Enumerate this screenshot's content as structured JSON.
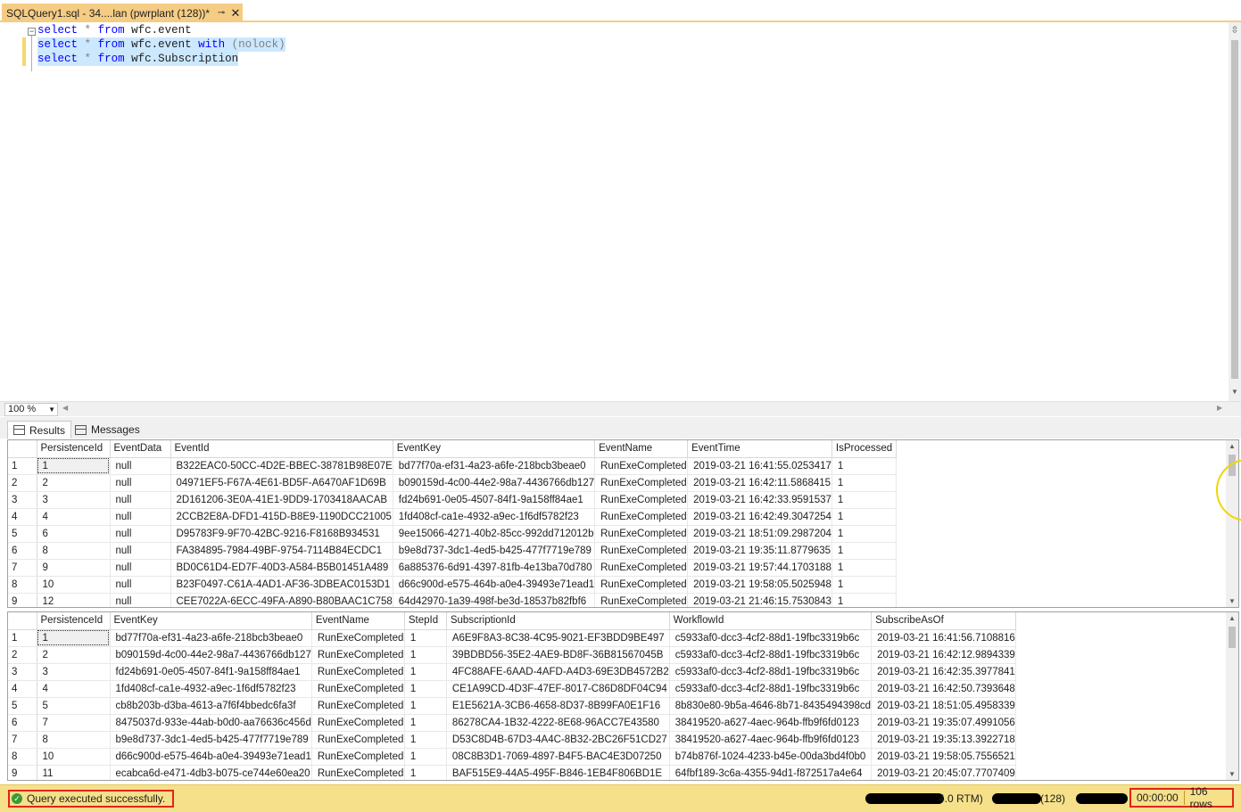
{
  "tab": {
    "title": "SQLQuery1.sql - 34....lan (pwrplant (128))*",
    "pin_icon": "pin-icon",
    "close_icon": "close-icon"
  },
  "editor": {
    "lines": [
      {
        "tokens": [
          "select",
          "*",
          "from",
          "wfc.event"
        ],
        "selected": false
      },
      {
        "tokens": [
          "select",
          "*",
          "from",
          "wfc.event",
          "with",
          "(nolock)"
        ],
        "selected": true
      },
      {
        "tokens": [
          "select",
          "*",
          "from",
          "wfc.Subscription"
        ],
        "selected": true
      }
    ],
    "zoom": "100 %"
  },
  "results_tabs": {
    "results": "Results",
    "messages": "Messages"
  },
  "grid1": {
    "columns": [
      "PersistenceId",
      "EventData",
      "EventId",
      "EventKey",
      "EventName",
      "EventTime",
      "IsProcessed"
    ],
    "rows": [
      [
        "1",
        "1",
        "null",
        "B322EAC0-50CC-4D2E-BBEC-38781B98E07E",
        "bd77f70a-ef31-4a23-a6fe-218bcb3beae0",
        "RunExeCompleted",
        "2019-03-21 16:41:55.0253417",
        "1"
      ],
      [
        "2",
        "2",
        "null",
        "04971EF5-F67A-4E61-BD5F-A6470AF1D69B",
        "b090159d-4c00-44e2-98a7-4436766db127",
        "RunExeCompleted",
        "2019-03-21 16:42:11.5868415",
        "1"
      ],
      [
        "3",
        "3",
        "null",
        "2D161206-3E0A-41E1-9DD9-1703418AACAB",
        "fd24b691-0e05-4507-84f1-9a158ff84ae1",
        "RunExeCompleted",
        "2019-03-21 16:42:33.9591537",
        "1"
      ],
      [
        "4",
        "4",
        "null",
        "2CCB2E8A-DFD1-415D-B8E9-1190DCC21005",
        "1fd408cf-ca1e-4932-a9ec-1f6df5782f23",
        "RunExeCompleted",
        "2019-03-21 16:42:49.3047254",
        "1"
      ],
      [
        "5",
        "6",
        "null",
        "D95783F9-9F70-42BC-9216-F8168B934531",
        "9ee15066-4271-40b2-85cc-992dd712012b",
        "RunExeCompleted",
        "2019-03-21 18:51:09.2987204",
        "1"
      ],
      [
        "6",
        "8",
        "null",
        "FA384895-7984-49BF-9754-7114B84ECDC1",
        "b9e8d737-3dc1-4ed5-b425-477f7719e789",
        "RunExeCompleted",
        "2019-03-21 19:35:11.8779635",
        "1"
      ],
      [
        "7",
        "9",
        "null",
        "BD0C61D4-ED7F-40D3-A584-B5B01451A489",
        "6a885376-6d91-4397-81fb-4e13ba70d780",
        "RunExeCompleted",
        "2019-03-21 19:57:44.1703188",
        "1"
      ],
      [
        "8",
        "10",
        "null",
        "B23F0497-C61A-4AD1-AF36-3DBEAC0153D1",
        "d66c900d-e575-464b-a0e4-39493e71ead1",
        "RunExeCompleted",
        "2019-03-21 19:58:05.5025948",
        "1"
      ],
      [
        "9",
        "12",
        "null",
        "CEE7022A-6ECC-49FA-A890-B80BAAC1C758",
        "64d42970-1a39-498f-be3d-18537b82fbf6",
        "RunExeCompleted",
        "2019-03-21 21:46:15.7530843",
        "1"
      ]
    ]
  },
  "grid2": {
    "columns": [
      "PersistenceId",
      "EventKey",
      "EventName",
      "StepId",
      "SubscriptionId",
      "WorkflowId",
      "SubscribeAsOf"
    ],
    "rows": [
      [
        "1",
        "1",
        "bd77f70a-ef31-4a23-a6fe-218bcb3beae0",
        "RunExeCompleted",
        "1",
        "A6E9F8A3-8C38-4C95-9021-EF3BDD9BE497",
        "c5933af0-dcc3-4cf2-88d1-19fbc3319b6c",
        "2019-03-21 16:41:56.7108816"
      ],
      [
        "2",
        "2",
        "b090159d-4c00-44e2-98a7-4436766db127",
        "RunExeCompleted",
        "1",
        "39BDBD56-35E2-4AE9-BD8F-36B81567045B",
        "c5933af0-dcc3-4cf2-88d1-19fbc3319b6c",
        "2019-03-21 16:42:12.9894339"
      ],
      [
        "3",
        "3",
        "fd24b691-0e05-4507-84f1-9a158ff84ae1",
        "RunExeCompleted",
        "1",
        "4FC88AFE-6AAD-4AFD-A4D3-69E3DB4572B2",
        "c5933af0-dcc3-4cf2-88d1-19fbc3319b6c",
        "2019-03-21 16:42:35.3977841"
      ],
      [
        "4",
        "4",
        "1fd408cf-ca1e-4932-a9ec-1f6df5782f23",
        "RunExeCompleted",
        "1",
        "CE1A99CD-4D3F-47EF-8017-C86D8DF04C94",
        "c5933af0-dcc3-4cf2-88d1-19fbc3319b6c",
        "2019-03-21 16:42:50.7393648"
      ],
      [
        "5",
        "5",
        "cb8b203b-d3ba-4613-a7f6f4bbedc6fa3f",
        "RunExeCompleted",
        "1",
        "E1E5621A-3CB6-4658-8D37-8B99FA0E1F16",
        "8b830e80-9b5a-4646-8b71-8435494398cd",
        "2019-03-21 18:51:05.4958339"
      ],
      [
        "6",
        "7",
        "8475037d-933e-44ab-b0d0-aa76636c456d",
        "RunExeCompleted",
        "1",
        "86278CA4-1B32-4222-8E68-96ACC7E43580",
        "38419520-a627-4aec-964b-ffb9f6fd0123",
        "2019-03-21 19:35:07.4991056"
      ],
      [
        "7",
        "8",
        "b9e8d737-3dc1-4ed5-b425-477f7719e789",
        "RunExeCompleted",
        "1",
        "D53C8D4B-67D3-4A4C-8B32-2BC26F51CD27",
        "38419520-a627-4aec-964b-ffb9f6fd0123",
        "2019-03-21 19:35:13.3922718"
      ],
      [
        "8",
        "10",
        "d66c900d-e575-464b-a0e4-39493e71ead1",
        "RunExeCompleted",
        "1",
        "08C8B3D1-7069-4897-B4F5-BAC4E3D07250",
        "b74b876f-1024-4233-b45e-00da3bd4f0b0",
        "2019-03-21 19:58:05.7556521"
      ],
      [
        "9",
        "11",
        "ecabca6d-e471-4db3-b075-ce744e60ea20",
        "RunExeCompleted",
        "1",
        "BAF515E9-44A5-495F-B846-1EB4F806BD1E",
        "64fbf189-3c6a-4355-94d1-f872517a4e64",
        "2019-03-21 20:45:07.7707409"
      ]
    ]
  },
  "status": {
    "message": "Query executed successfully.",
    "server_version": "4.0 RTM)",
    "user": "(128)",
    "elapsed": "00:00:00",
    "rows": "106 rows"
  },
  "colors": {
    "tab": "#f5cc84",
    "status": "#f6e08a",
    "highlight": "#e0261b",
    "selection": "#cce8ff",
    "keyword": "#0000ff"
  }
}
